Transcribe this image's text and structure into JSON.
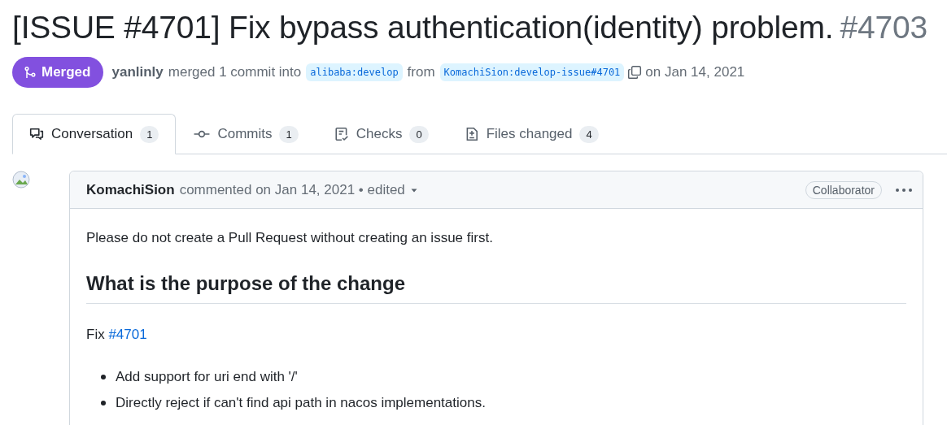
{
  "title": {
    "text": "[ISSUE #4701] Fix bypass authentication(identity) problem.",
    "number": "#4703"
  },
  "status": {
    "label": "Merged",
    "kind": "merged"
  },
  "merge_info": {
    "author": "yanlinly",
    "text": "merged 1 commit into",
    "base": "alibaba:develop",
    "from": "from",
    "head": "KomachiSion:develop-issue#4701",
    "date": "on Jan 14, 2021"
  },
  "tabs": [
    {
      "label": "Conversation",
      "count": "1",
      "kind": "conversation",
      "selected": true
    },
    {
      "label": "Commits",
      "count": "1",
      "kind": "commits",
      "selected": false
    },
    {
      "label": "Checks",
      "count": "0",
      "kind": "checks",
      "selected": false
    },
    {
      "label": "Files changed",
      "count": "4",
      "kind": "files",
      "selected": false
    }
  ],
  "comment": {
    "author": "KomachiSion",
    "meta": "commented on Jan 14, 2021 • edited",
    "role": "Collaborator",
    "intro": "Please do not create a Pull Request without creating an issue first.",
    "heading": "What is the purpose of the change",
    "fix_label": "Fix",
    "fix_link": "#4701",
    "bullets": [
      "Add support for uri end with '/'",
      "Directly reject if can't find api path in nacos implementations."
    ]
  }
}
